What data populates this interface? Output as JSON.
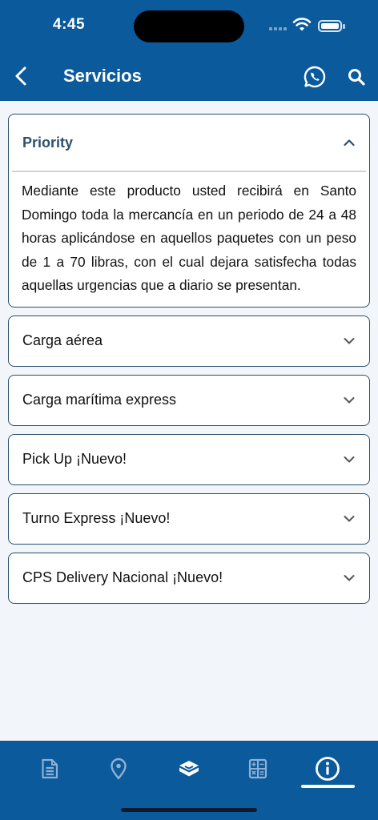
{
  "status_bar": {
    "time": "4:45"
  },
  "header": {
    "title": "Servicios",
    "back_icon": "chevron-left-icon",
    "whatsapp_icon": "whatsapp-icon",
    "search_icon": "search-icon"
  },
  "services": [
    {
      "title": "Priority",
      "expanded": true,
      "description": "Mediante este producto usted recibirá en Santo Domingo toda la mercancía en un periodo de 24 a 48 horas aplicándose en aquellos paquetes con un peso de 1 a 70 libras, con el cual dejara satisfecha todas aquellas urgencias que a diario se presentan."
    },
    {
      "title": "Carga aérea",
      "expanded": false
    },
    {
      "title": "Carga marítima express",
      "expanded": false
    },
    {
      "title": "Pick Up ¡Nuevo!",
      "expanded": false
    },
    {
      "title": "Turno Express ¡Nuevo!",
      "expanded": false
    },
    {
      "title": "CPS Delivery Nacional ¡Nuevo!",
      "expanded": false
    }
  ],
  "tab_bar": {
    "tabs": [
      {
        "icon": "document-icon",
        "selected": false
      },
      {
        "icon": "location-pin-icon",
        "selected": false
      },
      {
        "icon": "package-icon",
        "selected": false
      },
      {
        "icon": "calculator-icon",
        "selected": false
      },
      {
        "icon": "info-icon",
        "selected": true
      }
    ]
  },
  "colors": {
    "brand_blue": "#0a5a9c",
    "background": "#f2f5f9",
    "card_border": "#2a4e6c",
    "expanded_title": "#2f4f6c"
  }
}
